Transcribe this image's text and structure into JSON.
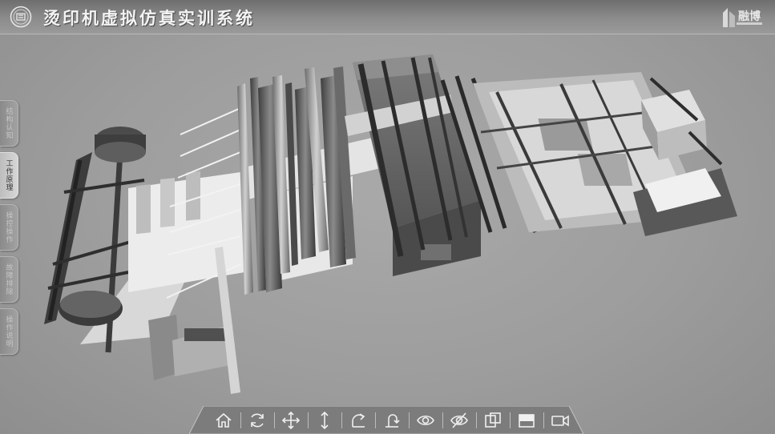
{
  "header": {
    "title": "烫印机虚拟仿真实训系统",
    "brand": "融博"
  },
  "sidebar": {
    "items": [
      {
        "label": "结构认知",
        "active": false
      },
      {
        "label": "工作原理",
        "active": true
      },
      {
        "label": "操控操作",
        "active": false
      },
      {
        "label": "故障排除",
        "active": false
      },
      {
        "label": "操作说明",
        "active": false
      }
    ]
  },
  "toolbar": {
    "tools": [
      {
        "icon": "home-icon"
      },
      {
        "icon": "refresh-icon"
      },
      {
        "icon": "move-icon"
      },
      {
        "icon": "vertical-move-icon"
      },
      {
        "icon": "rotate-icon"
      },
      {
        "icon": "rotate-vertical-icon"
      },
      {
        "icon": "show-icon"
      },
      {
        "icon": "hide-icon"
      },
      {
        "icon": "split-view-icon"
      },
      {
        "icon": "full-view-icon"
      },
      {
        "icon": "camera-icon"
      }
    ]
  },
  "colors": {
    "background": "#a0a0a0",
    "header": "#7a7a7a",
    "title_text": "#f4f4f4",
    "active_tab": "#d0d0d0"
  }
}
